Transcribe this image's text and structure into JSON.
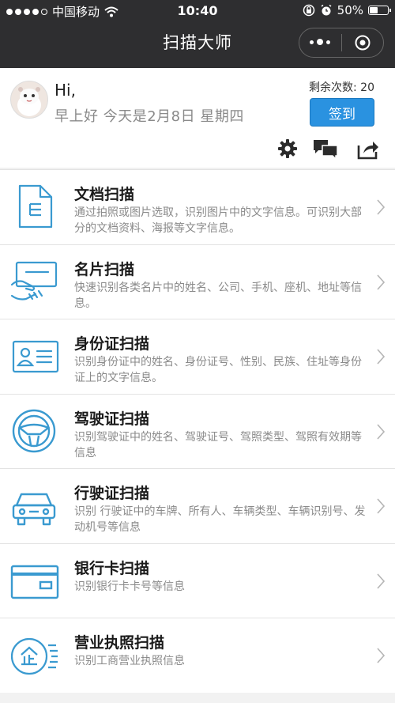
{
  "status": {
    "carrier": "中国移动",
    "time": "10:40",
    "battery": "50%",
    "battery_level": 0.5
  },
  "nav": {
    "title": "扫描大师"
  },
  "header": {
    "greeting": "Hi,",
    "date_line": "早上好  今天是2月8日  星期四",
    "remaining": "剩余次数: 20",
    "checkin_label": "签到"
  },
  "items": [
    {
      "title": "文档扫描",
      "desc": "通过拍照或图片选取，识别图片中的文字信息。可识别大部分的文档资料、海报等文字信息。",
      "icon": "document-icon"
    },
    {
      "title": "名片扫描",
      "desc": "快速识别各类名片中的姓名、公司、手机、座机、地址等信息。",
      "icon": "business-card-icon"
    },
    {
      "title": "身份证扫描",
      "desc": "识别身份证中的姓名、身份证号、性别、民族、住址等身份证上的文字信息。",
      "icon": "id-card-icon"
    },
    {
      "title": "驾驶证扫描",
      "desc": "识别驾驶证中的姓名、驾驶证号、驾照类型、驾照有效期等信息",
      "icon": "steering-wheel-icon"
    },
    {
      "title": "行驶证扫描",
      "desc": "识别 行驶证中的车牌、所有人、车辆类型、车辆识别号、发动机号等信息",
      "icon": "car-icon"
    },
    {
      "title": "银行卡扫描",
      "desc": "识别银行卡卡号等信息",
      "icon": "bank-card-icon"
    },
    {
      "title": "营业执照扫描",
      "desc": "识别工商营业执照信息",
      "icon": "business-license-icon"
    }
  ],
  "colors": {
    "accent": "#2a92e0",
    "icon": "#3a9ad0",
    "topbar": "#2e2e30"
  }
}
